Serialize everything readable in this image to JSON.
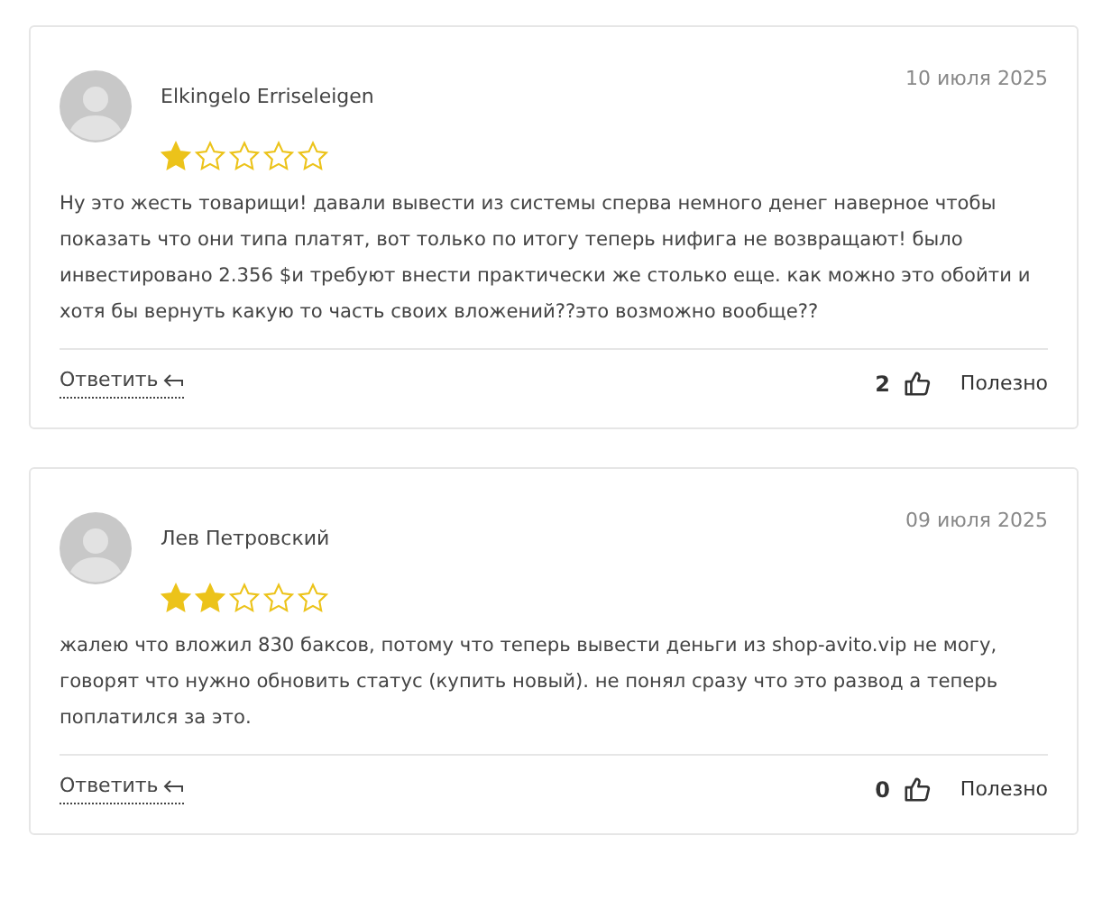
{
  "reviews": [
    {
      "author": "Elkingelo Erriseleigen",
      "date": "10 июля 2025",
      "stars": 1,
      "text": "Ну это жесть товарищи! давали вывести из системы сперва немного денег наверное чтобы показать что они типа платят, вот только по итогу теперь нифига не возвращают! было инвестировано 2.356 $и требуют внести практически же столько еще. как можно это обойти и хотя бы вернуть какую то часть своих вложений??это возможно вообще??",
      "reply": "Ответить",
      "likes": "2",
      "helpful": "Полезно"
    },
    {
      "author": "Лев Петровский",
      "date": "09 июля 2025",
      "stars": 2,
      "text": "жалею что вложил 830 баксов, потому что теперь вывести деньги из shop-avito.vip не могу, говорят что нужно обновить статус (купить новый). не понял сразу что это развод а теперь поплатился за это.",
      "reply": "Ответить",
      "likes": "0",
      "helpful": "Полезно"
    }
  ]
}
